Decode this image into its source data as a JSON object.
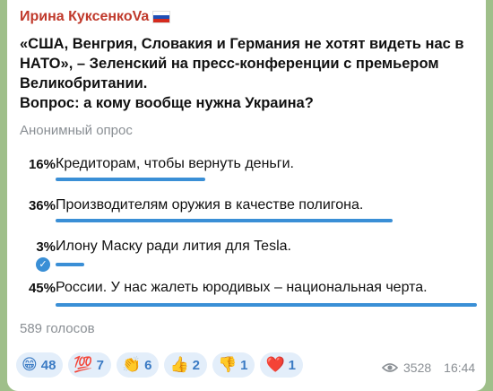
{
  "message": {
    "author": "Ирина КуксенкоVa",
    "question_lines": [
      "«США, Венгрия, Словакия и Германия не хотят видеть нас в",
      "НАТО», – Зеленский на пресс-конференции с премьером",
      "Великобритании.",
      "Вопрос: а кому вообще нужна Украина?"
    ],
    "poll_type": "Анонимный опрос",
    "options": [
      {
        "percent": "16%",
        "text": "Кредиторам, чтобы вернуть деньги.",
        "fraction": 0.16,
        "selected": false
      },
      {
        "percent": "36%",
        "text": "Производителям оружия в качестве полигона.",
        "fraction": 0.36,
        "selected": false
      },
      {
        "percent": "3%",
        "text": "Илону Маску ради лития для Tesla.",
        "fraction": 0.03,
        "selected": true
      },
      {
        "percent": "45%",
        "text": "России. У нас жалеть юродивых – национальная черта.",
        "fraction": 0.45,
        "selected": false
      }
    ],
    "votes": "589 голосов",
    "reactions": [
      {
        "emoji": "😁",
        "count": "48",
        "icon": "grin-emoji-icon"
      },
      {
        "emoji": "💯",
        "count": "7",
        "icon": "hundred-emoji-icon"
      },
      {
        "emoji": "👏",
        "count": "6",
        "icon": "clap-emoji-icon"
      },
      {
        "emoji": "👍",
        "count": "2",
        "icon": "thumbs-up-emoji-icon"
      },
      {
        "emoji": "👎",
        "count": "1",
        "icon": "thumbs-down-emoji-icon"
      },
      {
        "emoji": "❤️",
        "count": "1",
        "icon": "heart-emoji-icon"
      }
    ],
    "views": "3528",
    "time": "16:44"
  },
  "colors": {
    "author": "#c0392b",
    "accent": "#3a8fd6",
    "background": "#9fbf8a"
  }
}
